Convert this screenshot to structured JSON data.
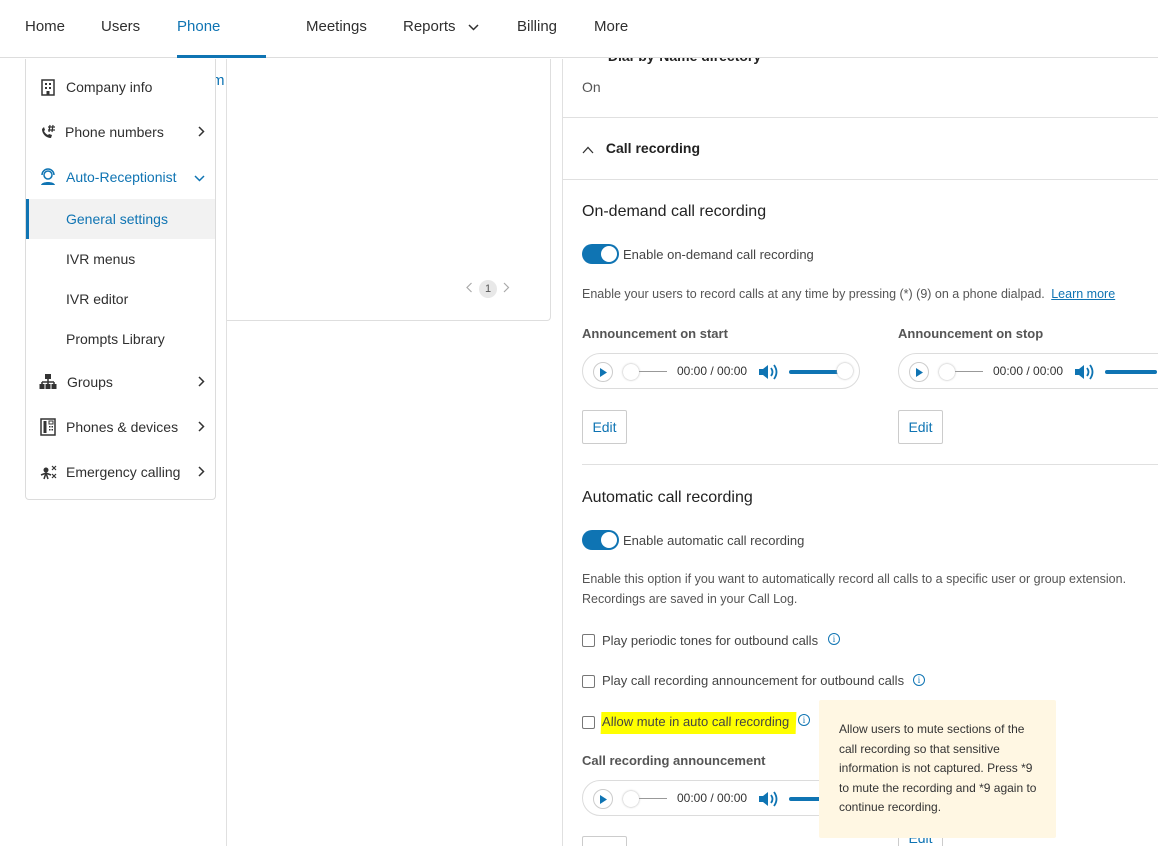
{
  "topnav": {
    "items": [
      {
        "label": "Home"
      },
      {
        "label": "Users"
      },
      {
        "label": "Phone system",
        "active": true
      },
      {
        "label": "Meetings"
      },
      {
        "label": "Reports",
        "has_dropdown": true
      },
      {
        "label": "Billing"
      },
      {
        "label": "More"
      }
    ]
  },
  "sidebar": {
    "items": [
      {
        "label": "Company info",
        "icon": "building-icon"
      },
      {
        "label": "Phone numbers",
        "icon": "phone-hash-icon"
      },
      {
        "label": "Auto-Receptionist",
        "icon": "receptionist-icon",
        "expanded": true
      },
      {
        "label": "Groups",
        "icon": "org-chart-icon"
      },
      {
        "label": "Phones & devices",
        "icon": "desk-phone-icon"
      },
      {
        "label": "Emergency calling",
        "icon": "emergency-icon"
      }
    ],
    "subitems": [
      {
        "label": "General settings",
        "selected": true
      },
      {
        "label": "IVR menus"
      },
      {
        "label": "IVR editor"
      },
      {
        "label": "Prompts Library"
      }
    ]
  },
  "pager": {
    "page": "1"
  },
  "main": {
    "dial_by_name": {
      "title": "Dial-by-Name directory",
      "value": "On"
    },
    "call_recording_section": {
      "title": "Call recording"
    },
    "on_demand": {
      "heading": "On-demand call recording",
      "toggle_label": "Enable on-demand call recording",
      "toggle_on": true,
      "description": "Enable your users to record calls at any time by pressing (*) (9) on a phone dialpad.",
      "learn_more": "Learn more",
      "announcement_start_label": "Announcement on start",
      "announcement_stop_label": "Announcement on stop",
      "player_time": "00:00 / 00:00",
      "edit_label": "Edit"
    },
    "automatic": {
      "heading": "Automatic call recording",
      "toggle_label": "Enable automatic call recording",
      "toggle_on": true,
      "description_line1": "Enable this option if you want to automatically record all calls to a specific user or group extension.",
      "description_line2": "Recordings are saved in your Call Log.",
      "options": [
        {
          "label": "Play periodic tones for outbound calls",
          "checked": false
        },
        {
          "label": "Play call recording announcement for outbound calls",
          "checked": false
        },
        {
          "label": "Allow mute in auto call recording",
          "checked": false,
          "highlighted": true
        }
      ],
      "announcement_label": "Call recording announcement",
      "player_time": "00:00 / 00:00",
      "edit_label": "Edit"
    }
  },
  "tooltip": {
    "text": "Allow users to mute sections of the call recording so that sensitive information is not captured. Press *9 to mute the recording and *9 again to continue recording."
  },
  "colors": {
    "accent": "#0f74b3",
    "highlight": "#ffff00",
    "tooltip_bg": "#fff7e3"
  }
}
